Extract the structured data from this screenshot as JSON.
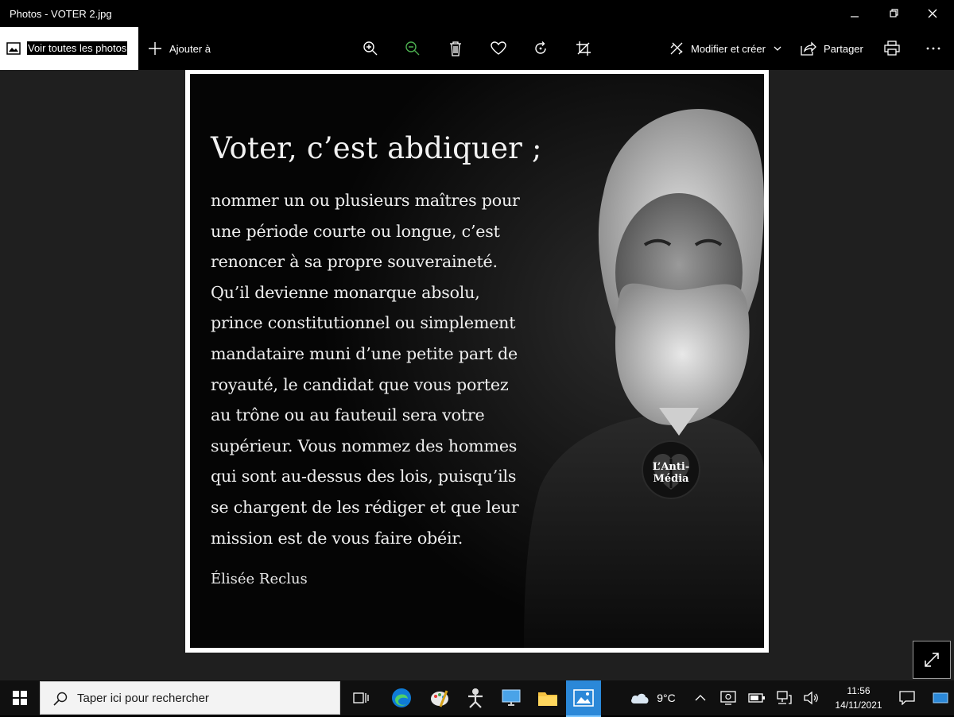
{
  "window": {
    "title": "Photos - VOTER 2.jpg",
    "icons": [
      "minimize-icon",
      "restore-icon",
      "close-icon"
    ]
  },
  "toolbar": {
    "view_all": "Voir toutes les photos",
    "add_to": "Ajouter à",
    "edit_create": "Modifier et créer",
    "share": "Partager",
    "icons": [
      "zoom-in-icon",
      "zoom-out-icon",
      "delete-icon",
      "favorite-icon",
      "rotate-icon",
      "crop-icon",
      "print-icon",
      "more-icon"
    ],
    "accent": "#4caf50"
  },
  "photo": {
    "headline": "Voter, c’est abdiquer ;",
    "body": "nommer un ou plusieurs maîtres pour\nune période courte ou longue, c’est\nrenoncer à sa propre souveraineté.\nQu’il devienne monarque absolu,\nprince constitutionnel ou simplement\nmandataire muni d’une petite part de\nroyauté, le candidat que vous portez\nau trône ou au fauteuil sera votre\nsupérieur. Vous nommez des hommes\nqui sont au-dessus des lois, puisqu’ils\nse chargent de les rédiger et que leur\nmission est de vous faire obéir.",
    "author": "Élisée Reclus",
    "badge": "L’Anti-Média"
  },
  "taskbar": {
    "search_placeholder": "Taper ici pour rechercher",
    "weather": "9°C",
    "time": "11:56",
    "date": "14/11/2021",
    "apps": [
      "task-view-icon",
      "edge-icon",
      "paint-icon",
      "app-icon",
      "remote-desktop-icon",
      "file-explorer-icon",
      "photos-icon"
    ]
  }
}
